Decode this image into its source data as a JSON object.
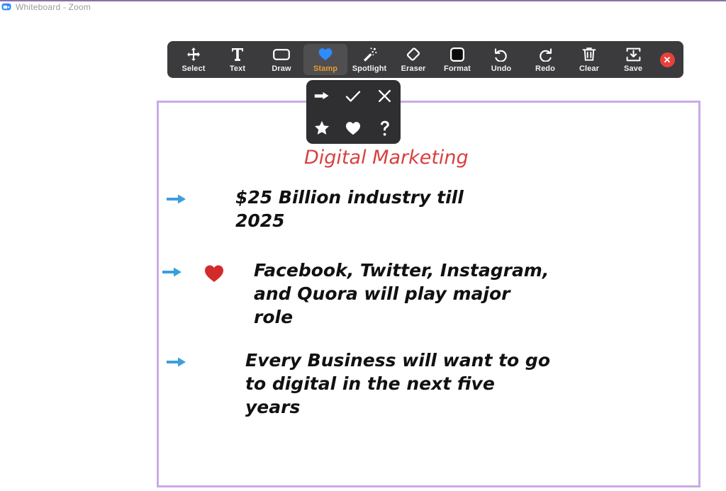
{
  "window": {
    "title": "Whiteboard - Zoom",
    "logo_icon": "zoom-logo-icon"
  },
  "toolbar": {
    "items": [
      {
        "label": "Select",
        "icon": "move-arrows-icon",
        "active": false
      },
      {
        "label": "Text",
        "icon": "text-t-icon",
        "active": false
      },
      {
        "label": "Draw",
        "icon": "rectangle-icon",
        "active": false
      },
      {
        "label": "Stamp",
        "icon": "heart-icon",
        "active": true
      },
      {
        "label": "Spotlight",
        "icon": "magic-wand-icon",
        "active": false
      },
      {
        "label": "Eraser",
        "icon": "eraser-icon",
        "active": false
      },
      {
        "label": "Format",
        "icon": "filled-square-icon",
        "active": false
      },
      {
        "label": "Undo",
        "icon": "undo-arrow-icon",
        "active": false
      },
      {
        "label": "Redo",
        "icon": "redo-arrow-icon",
        "active": false
      },
      {
        "label": "Clear",
        "icon": "trash-can-icon",
        "active": false
      },
      {
        "label": "Save",
        "icon": "save-download-icon",
        "active": false
      }
    ],
    "close_button": {
      "icon": "close-x-icon",
      "glyph": "✕"
    },
    "active_label_color": "#e79b2f",
    "background_color": "#3b3b3d"
  },
  "stamp_panel": {
    "open": true,
    "options": [
      {
        "name": "stamp-arrow",
        "icon": "arrow-right-icon"
      },
      {
        "name": "stamp-checkmark",
        "icon": "check-icon"
      },
      {
        "name": "stamp-cross",
        "icon": "x-mark-icon"
      },
      {
        "name": "stamp-star",
        "icon": "star-icon"
      },
      {
        "name": "stamp-heart",
        "icon": "heart-icon"
      },
      {
        "name": "stamp-question",
        "icon": "question-mark-icon"
      }
    ]
  },
  "whiteboard": {
    "border_color": "#c9aae8",
    "title": "Digital Marketing",
    "title_color": "#d94040",
    "bullets": [
      {
        "text": "$25 Billion industry till 2025",
        "stamps": [
          "arrow-right-icon"
        ]
      },
      {
        "text": "Facebook, Twitter, Instagram, and Quora will play major role",
        "stamps": [
          "arrow-right-icon",
          "heart-icon"
        ]
      },
      {
        "text": "Every Business will want to go to digital in the next five years",
        "stamps": [
          "arrow-right-icon"
        ]
      }
    ],
    "stamp_colors": {
      "arrow": "#3b9ede",
      "heart": "#d42a2a"
    }
  }
}
